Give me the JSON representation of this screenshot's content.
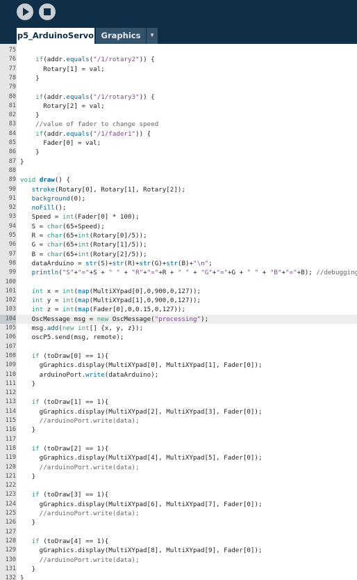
{
  "toolbar": {
    "run_icon": "play-icon",
    "stop_icon": "stop-icon"
  },
  "tabs": {
    "active": "p5_ArduinoServo",
    "other": "Graphics",
    "menu_glyph": "▾"
  },
  "colors": {
    "toolbar_bg": "#0f2f48",
    "keyword": "#33997e",
    "function": "#006699",
    "string": "#7d4793",
    "comment": "#666666"
  },
  "editor": {
    "highlight_line": 104,
    "lines": [
      {
        "n": "75",
        "t": []
      },
      {
        "n": "76",
        "t": [
          [
            "    ",
            ""
          ],
          [
            "if",
            "kw"
          ],
          [
            "(addr.",
            ""
          ],
          [
            "equals",
            "fn"
          ],
          [
            "(",
            ""
          ],
          [
            "\"/1/rotary2\"",
            "str"
          ],
          [
            ")) {",
            ""
          ]
        ]
      },
      {
        "n": "77",
        "t": [
          [
            "      Rotary[1] = val;",
            ""
          ]
        ]
      },
      {
        "n": "78",
        "t": [
          [
            "    }",
            ""
          ]
        ]
      },
      {
        "n": "79",
        "t": []
      },
      {
        "n": "80",
        "t": [
          [
            "    ",
            ""
          ],
          [
            "if",
            "kw"
          ],
          [
            "(addr.",
            ""
          ],
          [
            "equals",
            "fn"
          ],
          [
            "(",
            ""
          ],
          [
            "\"/1/rotary3\"",
            "str"
          ],
          [
            ")) {",
            ""
          ]
        ]
      },
      {
        "n": "81",
        "t": [
          [
            "      Rotary[2] = val;",
            ""
          ]
        ]
      },
      {
        "n": "82",
        "t": [
          [
            "    }",
            ""
          ]
        ]
      },
      {
        "n": "83",
        "t": [
          [
            "    ",
            ""
          ],
          [
            "//value of fader to change speed",
            "cm"
          ]
        ]
      },
      {
        "n": "84",
        "t": [
          [
            "    ",
            ""
          ],
          [
            "if",
            "kw"
          ],
          [
            "(addr.",
            ""
          ],
          [
            "equals",
            "fn"
          ],
          [
            "(",
            ""
          ],
          [
            "\"/1/fader1\"",
            "str"
          ],
          [
            ")) {",
            ""
          ]
        ]
      },
      {
        "n": "85",
        "t": [
          [
            "      Fader[0] = val;",
            ""
          ]
        ]
      },
      {
        "n": "86",
        "t": [
          [
            "    }",
            ""
          ]
        ]
      },
      {
        "n": "87",
        "t": [
          [
            "}",
            ""
          ]
        ]
      },
      {
        "n": "88",
        "t": []
      },
      {
        "n": "89",
        "t": [
          [
            "void",
            "kw"
          ],
          [
            " ",
            ""
          ],
          [
            "draw",
            "fnb"
          ],
          [
            "() {",
            ""
          ]
        ]
      },
      {
        "n": "90",
        "t": [
          [
            "   ",
            ""
          ],
          [
            "stroke",
            "fn"
          ],
          [
            "(Rotary[0], Rotary[1], Rotary[2]);",
            ""
          ]
        ]
      },
      {
        "n": "91",
        "t": [
          [
            "   ",
            ""
          ],
          [
            "background",
            "fn"
          ],
          [
            "(0);",
            ""
          ]
        ]
      },
      {
        "n": "92",
        "t": [
          [
            "   ",
            ""
          ],
          [
            "noFill",
            "fn"
          ],
          [
            "();",
            ""
          ]
        ]
      },
      {
        "n": "93",
        "t": [
          [
            "   Speed = ",
            ""
          ],
          [
            "int",
            "kw"
          ],
          [
            "(Fader[0] * 100);",
            ""
          ]
        ]
      },
      {
        "n": "94",
        "t": [
          [
            "   S = ",
            ""
          ],
          [
            "char",
            "kw"
          ],
          [
            "(65+Speed);",
            ""
          ]
        ]
      },
      {
        "n": "95",
        "t": [
          [
            "   R = ",
            ""
          ],
          [
            "char",
            "kw"
          ],
          [
            "(65+",
            ""
          ],
          [
            "int",
            "kw"
          ],
          [
            "(Rotary[0]/5));",
            ""
          ]
        ]
      },
      {
        "n": "96",
        "t": [
          [
            "   G = ",
            ""
          ],
          [
            "char",
            "kw"
          ],
          [
            "(65+",
            ""
          ],
          [
            "int",
            "kw"
          ],
          [
            "(Rotary[1]/5));",
            ""
          ]
        ]
      },
      {
        "n": "97",
        "t": [
          [
            "   B = ",
            ""
          ],
          [
            "char",
            "kw"
          ],
          [
            "(65+",
            ""
          ],
          [
            "int",
            "kw"
          ],
          [
            "(Rotary[2]/5));",
            ""
          ]
        ]
      },
      {
        "n": "98",
        "t": [
          [
            "   dataArduino = ",
            ""
          ],
          [
            "str",
            "fn"
          ],
          [
            "(S)+",
            ""
          ],
          [
            "str",
            "fn"
          ],
          [
            "(R)+",
            ""
          ],
          [
            "str",
            "fn"
          ],
          [
            "(G)+",
            ""
          ],
          [
            "str",
            "fn"
          ],
          [
            "(B)+",
            ""
          ],
          [
            "\"\\n\"",
            "str"
          ],
          [
            ";",
            ""
          ]
        ]
      },
      {
        "n": "99",
        "t": [
          [
            "   ",
            ""
          ],
          [
            "println",
            "fn"
          ],
          [
            "(",
            ""
          ],
          [
            "\"S\"",
            "str"
          ],
          [
            "+",
            ""
          ],
          [
            "\"=\"",
            "str"
          ],
          [
            "+S + ",
            ""
          ],
          [
            "\" \"",
            "str"
          ],
          [
            " + ",
            ""
          ],
          [
            "\"R\"",
            "str"
          ],
          [
            "+",
            ""
          ],
          [
            "\"=\"",
            "str"
          ],
          [
            "+R + ",
            ""
          ],
          [
            "\" \"",
            "str"
          ],
          [
            " + ",
            ""
          ],
          [
            "\"G\"",
            "str"
          ],
          [
            "+",
            ""
          ],
          [
            "\"=\"",
            "str"
          ],
          [
            "+G + ",
            ""
          ],
          [
            "\" \"",
            "str"
          ],
          [
            " + ",
            ""
          ],
          [
            "\"B\"",
            "str"
          ],
          [
            "+",
            ""
          ],
          [
            "\"=\"",
            "str"
          ],
          [
            "+B); ",
            ""
          ],
          [
            "//debugging",
            "cm"
          ]
        ]
      },
      {
        "n": "100",
        "t": []
      },
      {
        "n": "101",
        "t": [
          [
            "   ",
            ""
          ],
          [
            "int",
            "kw"
          ],
          [
            " x = ",
            ""
          ],
          [
            "int",
            "kw"
          ],
          [
            "(",
            ""
          ],
          [
            "map",
            "fn"
          ],
          [
            "(MultiXYpad[0],0,900,0,127));",
            ""
          ]
        ]
      },
      {
        "n": "102",
        "t": [
          [
            "   ",
            ""
          ],
          [
            "int",
            "kw"
          ],
          [
            " y = ",
            ""
          ],
          [
            "int",
            "kw"
          ],
          [
            "(",
            ""
          ],
          [
            "map",
            "fn"
          ],
          [
            "(MultiXYpad[1],0,900,0,127));",
            ""
          ]
        ]
      },
      {
        "n": "103",
        "t": [
          [
            "   ",
            ""
          ],
          [
            "int",
            "kw"
          ],
          [
            " z = ",
            ""
          ],
          [
            "int",
            "kw"
          ],
          [
            "(",
            ""
          ],
          [
            "map",
            "fn"
          ],
          [
            "(Fader[0],0,0.15,0,127));",
            ""
          ]
        ]
      },
      {
        "n": "104",
        "t": [
          [
            "   OscMessage msg = ",
            ""
          ],
          [
            "new",
            "kw"
          ],
          [
            " OscMessage(",
            ""
          ],
          [
            "\"processing\"",
            "str"
          ],
          [
            ");",
            ""
          ]
        ]
      },
      {
        "n": "105",
        "t": [
          [
            "   msg.",
            ""
          ],
          [
            "add",
            "fn"
          ],
          [
            "(",
            ""
          ],
          [
            "new",
            "kw"
          ],
          [
            " ",
            ""
          ],
          [
            "int",
            "kw"
          ],
          [
            "[] {x, y, z});",
            ""
          ]
        ]
      },
      {
        "n": "106",
        "t": [
          [
            "   oscP5.send(msg, remote);",
            ""
          ]
        ]
      },
      {
        "n": "107",
        "t": []
      },
      {
        "n": "108",
        "t": [
          [
            "   ",
            ""
          ],
          [
            "if",
            "kw"
          ],
          [
            " (toDraw[0] == 1){",
            ""
          ]
        ]
      },
      {
        "n": "109",
        "t": [
          [
            "     gGraphics.display(MultiXYpad[0], MultiXYpad[1], Fader[0]);",
            ""
          ]
        ]
      },
      {
        "n": "110",
        "t": [
          [
            "     arduinoPort.",
            ""
          ],
          [
            "write",
            "fn"
          ],
          [
            "(dataArduino);",
            ""
          ]
        ]
      },
      {
        "n": "111",
        "t": [
          [
            "   }",
            ""
          ]
        ]
      },
      {
        "n": "112",
        "t": []
      },
      {
        "n": "113",
        "t": [
          [
            "   ",
            ""
          ],
          [
            "if",
            "kw"
          ],
          [
            " (toDraw[1] == 1){",
            ""
          ]
        ]
      },
      {
        "n": "114",
        "t": [
          [
            "     gGraphics.display(MultiXYpad[2], MultiXYpad[3], Fader[0]);",
            ""
          ]
        ]
      },
      {
        "n": "115",
        "t": [
          [
            "     ",
            ""
          ],
          [
            "//arduinoPort.write(data);",
            "cm"
          ]
        ]
      },
      {
        "n": "116",
        "t": [
          [
            "   }",
            ""
          ]
        ]
      },
      {
        "n": "117",
        "t": []
      },
      {
        "n": "118",
        "t": [
          [
            "   ",
            ""
          ],
          [
            "if",
            "kw"
          ],
          [
            " (toDraw[2] == 1){",
            ""
          ]
        ]
      },
      {
        "n": "119",
        "t": [
          [
            "     gGraphics.display(MultiXYpad[4], MultiXYpad[5], Fader[0]);",
            ""
          ]
        ]
      },
      {
        "n": "120",
        "t": [
          [
            "     ",
            ""
          ],
          [
            "//arduinoPort.write(data);",
            "cm"
          ]
        ]
      },
      {
        "n": "121",
        "t": [
          [
            "   }",
            ""
          ]
        ]
      },
      {
        "n": "122",
        "t": []
      },
      {
        "n": "123",
        "t": [
          [
            "   ",
            ""
          ],
          [
            "if",
            "kw"
          ],
          [
            " (toDraw[3] == 1){",
            ""
          ]
        ]
      },
      {
        "n": "124",
        "t": [
          [
            "     gGraphics.display(MultiXYpad[6], MultiXYpad[7], Fader[0]);",
            ""
          ]
        ]
      },
      {
        "n": "125",
        "t": [
          [
            "     ",
            ""
          ],
          [
            "//arduinoPort.write(data);",
            "cm"
          ]
        ]
      },
      {
        "n": "126",
        "t": [
          [
            "   }",
            ""
          ]
        ]
      },
      {
        "n": "127",
        "t": []
      },
      {
        "n": "128",
        "t": [
          [
            "   ",
            ""
          ],
          [
            "if",
            "kw"
          ],
          [
            " (toDraw[4] == 1){",
            ""
          ]
        ]
      },
      {
        "n": "129",
        "t": [
          [
            "     gGraphics.display(MultiXYpad[8], MultiXYpad[9], Fader[0]);",
            ""
          ]
        ]
      },
      {
        "n": "130",
        "t": [
          [
            "     ",
            ""
          ],
          [
            "//arduinoPort.write(data);",
            "cm"
          ]
        ]
      },
      {
        "n": "131",
        "t": [
          [
            "   }",
            ""
          ]
        ]
      },
      {
        "n": "132",
        "t": [
          [
            "}",
            ""
          ]
        ]
      }
    ]
  }
}
